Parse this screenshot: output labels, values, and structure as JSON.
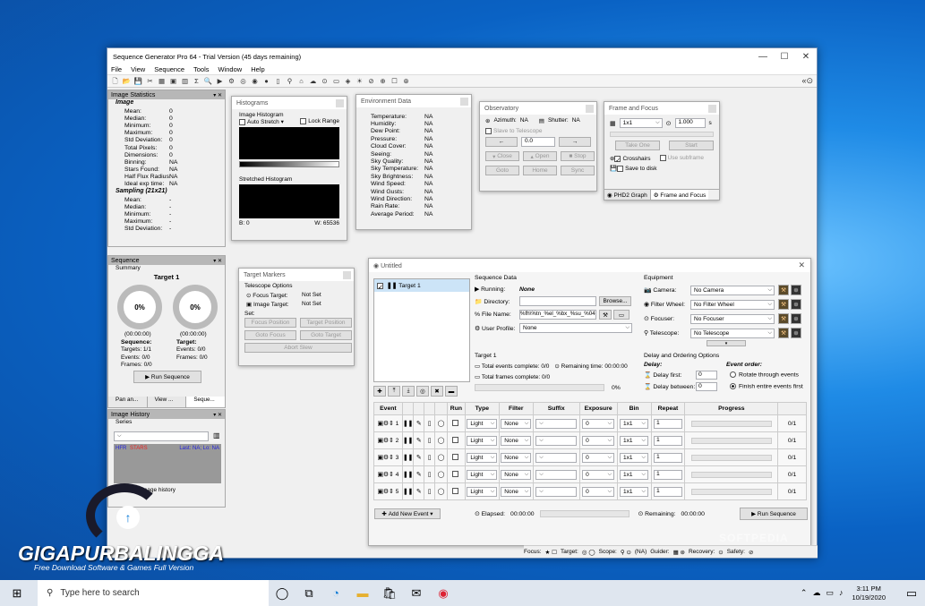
{
  "window": {
    "title": "Sequence Generator Pro 64 - Trial Version (45 days remaining)"
  },
  "menu": [
    "File",
    "View",
    "Sequence",
    "Tools",
    "Window",
    "Help"
  ],
  "image_stats": {
    "title": "Image Statistics",
    "image_label": "Image",
    "rows": [
      {
        "k": "Mean:",
        "v": "0"
      },
      {
        "k": "Median:",
        "v": "0"
      },
      {
        "k": "Minimum:",
        "v": "0"
      },
      {
        "k": "Maximum:",
        "v": "0"
      },
      {
        "k": "Std Deviation:",
        "v": "0"
      },
      {
        "k": "Total Pixels:",
        "v": "0"
      },
      {
        "k": "Dimensions:",
        "v": "0"
      },
      {
        "k": "Binning:",
        "v": "NA"
      },
      {
        "k": "Stars Found:",
        "v": "NA"
      },
      {
        "k": "Half Flux Radius:",
        "v": "NA"
      },
      {
        "k": "Ideal exp time:",
        "v": "NA"
      }
    ],
    "sampling_label": "Sampling (21x21)",
    "sampling_rows": [
      {
        "k": "Mean:",
        "v": "-"
      },
      {
        "k": "Median:",
        "v": "-"
      },
      {
        "k": "Minimum:",
        "v": "-"
      },
      {
        "k": "Maximum:",
        "v": "-"
      },
      {
        "k": "Std Deviation:",
        "v": "-"
      }
    ]
  },
  "seq_dock": {
    "title": "Sequence",
    "summary": "Summary",
    "target": "Target 1",
    "pct1": "0%",
    "pct2": "0%",
    "t1": "(00:00:00)",
    "t2": "(00:00:00)",
    "seq_label": "Sequence:",
    "tgt_label": "Target:",
    "targets": "Targets:  1/1",
    "events_l": "Events:   0/0",
    "frames_l": "Frames:   0/0",
    "events_r": "Events:   0/0",
    "frames_r": "Frames:   0/0",
    "run": "Run Sequence",
    "tabs": [
      "Pan an...",
      "View ...",
      "Seque..."
    ]
  },
  "history": {
    "title": "Image History",
    "series": "Series",
    "hfr": "HFR",
    "stars": "STARS",
    "last": "Last: NA; Lo: NA",
    "foot": "Image history"
  },
  "histograms": {
    "title": "Histograms",
    "image_hist": "Image Histogram",
    "auto": "Auto Stretch",
    "lock": "Lock Range",
    "stretched": "Stretched Histogram",
    "b": "B: 0",
    "w": "W: 65536"
  },
  "env": {
    "title": "Environment Data",
    "rows": [
      {
        "k": "Temperature:",
        "v": "NA"
      },
      {
        "k": "Humidity:",
        "v": "NA"
      },
      {
        "k": "Dew Point:",
        "v": "NA"
      },
      {
        "k": "Pressure:",
        "v": "NA"
      },
      {
        "k": "Cloud Cover:",
        "v": "NA"
      },
      {
        "k": "Seeing:",
        "v": "NA"
      },
      {
        "k": "Sky Quality:",
        "v": "NA"
      },
      {
        "k": "Sky Temperature:",
        "v": "NA"
      },
      {
        "k": "Sky Brightness:",
        "v": "NA"
      },
      {
        "k": "Wind Speed:",
        "v": "NA"
      },
      {
        "k": "Wind Gusts:",
        "v": "NA"
      },
      {
        "k": "Wind Direction:",
        "v": "NA"
      },
      {
        "k": "Rain Rate:",
        "v": "NA"
      },
      {
        "k": "Average Period:",
        "v": "NA"
      }
    ]
  },
  "obs": {
    "title": "Observatory",
    "azimuth": "Azimuth:",
    "az_v": "NA",
    "shutter": "Shutter:",
    "sh_v": "NA",
    "slave": "Slave to Telescope",
    "val": "0.0",
    "close": "Close",
    "open": "Open",
    "stop": "Stop",
    "goto": "Goto",
    "home": "Home",
    "sync": "Sync"
  },
  "ff": {
    "title": "Frame and Focus",
    "bin": "1x1",
    "exp": "1.000",
    "s": "s",
    "take": "Take One",
    "start": "Start",
    "cross": "Crosshairs",
    "subframe": "Use subframe",
    "save": "Save to disk",
    "tab1": "PHD2 Graph",
    "tab2": "Frame and Focus"
  },
  "markers": {
    "title": "Target Markers",
    "opts": "Telescope Options",
    "focus_t": "Focus Target:",
    "focus_v": "Not Set",
    "image_t": "Image Target:",
    "image_v": "Not Set",
    "set": "Set:",
    "b1": "Focus Position",
    "b2": "Target Position",
    "b3": "Goto Focus",
    "b4": "Goto Target",
    "b5": "Abort Slew"
  },
  "untitled": {
    "title": "Untitled",
    "target": "Target 1",
    "seqdata": "Sequence Data",
    "running_l": "Running:",
    "running_v": "None",
    "dir_l": "Directory:",
    "browse": "Browse...",
    "file_l": "File Name:",
    "file_v": "%fh\\%tn_%el_%bx_%su_%04",
    "profile_l": "User Profile:",
    "profile_v": "None",
    "equip": "Equipment",
    "camera_l": "Camera:",
    "camera_v": "No Camera",
    "fw_l": "Filter Wheel:",
    "fw_v": "No Filter Wheel",
    "foc_l": "Focuser:",
    "foc_v": "No Focuser",
    "tel_l": "Telescope:",
    "tel_v": "No Telescope",
    "tgt_grp": "Target 1",
    "tec": "Total events complete: 0/0",
    "rem": "Remaining time: 00:00:00",
    "tfc": "Total frames complete: 0/0",
    "pct": "0%",
    "delay_grp": "Delay and Ordering Options",
    "delay": "Delay:",
    "order": "Event order:",
    "df": "Delay first:",
    "db": "Delay between:",
    "dfv": "0",
    "dbv": "0",
    "rot": "Rotate through events",
    "fin": "Finish entire events first",
    "cols": [
      "Event",
      "",
      "",
      "",
      "",
      "Run",
      "Type",
      "Filter",
      "Suffix",
      "Exposure",
      "Bin",
      "Repeat",
      "Progress",
      ""
    ],
    "rows": [
      {
        "n": "1",
        "type": "Light",
        "filter": "None",
        "exp": "0",
        "bin": "1x1",
        "rep": "1",
        "prog": "0/1"
      },
      {
        "n": "2",
        "type": "Light",
        "filter": "None",
        "exp": "0",
        "bin": "1x1",
        "rep": "1",
        "prog": "0/1"
      },
      {
        "n": "3",
        "type": "Light",
        "filter": "None",
        "exp": "0",
        "bin": "1x1",
        "rep": "1",
        "prog": "0/1"
      },
      {
        "n": "4",
        "type": "Light",
        "filter": "None",
        "exp": "0",
        "bin": "1x1",
        "rep": "1",
        "prog": "0/1"
      },
      {
        "n": "5",
        "type": "Light",
        "filter": "None",
        "exp": "0",
        "bin": "1x1",
        "rep": "1",
        "prog": "0/1"
      }
    ],
    "add": "Add New Event",
    "elapsed_l": "Elapsed:",
    "elapsed_v": "00:00:00",
    "remaining_l": "Remaining:",
    "remaining_v": "00:00:00",
    "run": "Run Sequence"
  },
  "status": {
    "focus": "Focus:",
    "target": "Target:",
    "scope": "Scope:",
    "na": "(NA)",
    "guider": "Guider:",
    "recovery": "Recovery:",
    "safety": "Safety:"
  },
  "watermark": {
    "brand": "GIGAPURBALINGGA",
    "tagline": "Free Download Software & Games Full Version",
    "softpedia": "SOFTPEDIA"
  },
  "taskbar": {
    "search": "Type here to search",
    "time": "3:11 PM",
    "date": "10/19/2020"
  }
}
